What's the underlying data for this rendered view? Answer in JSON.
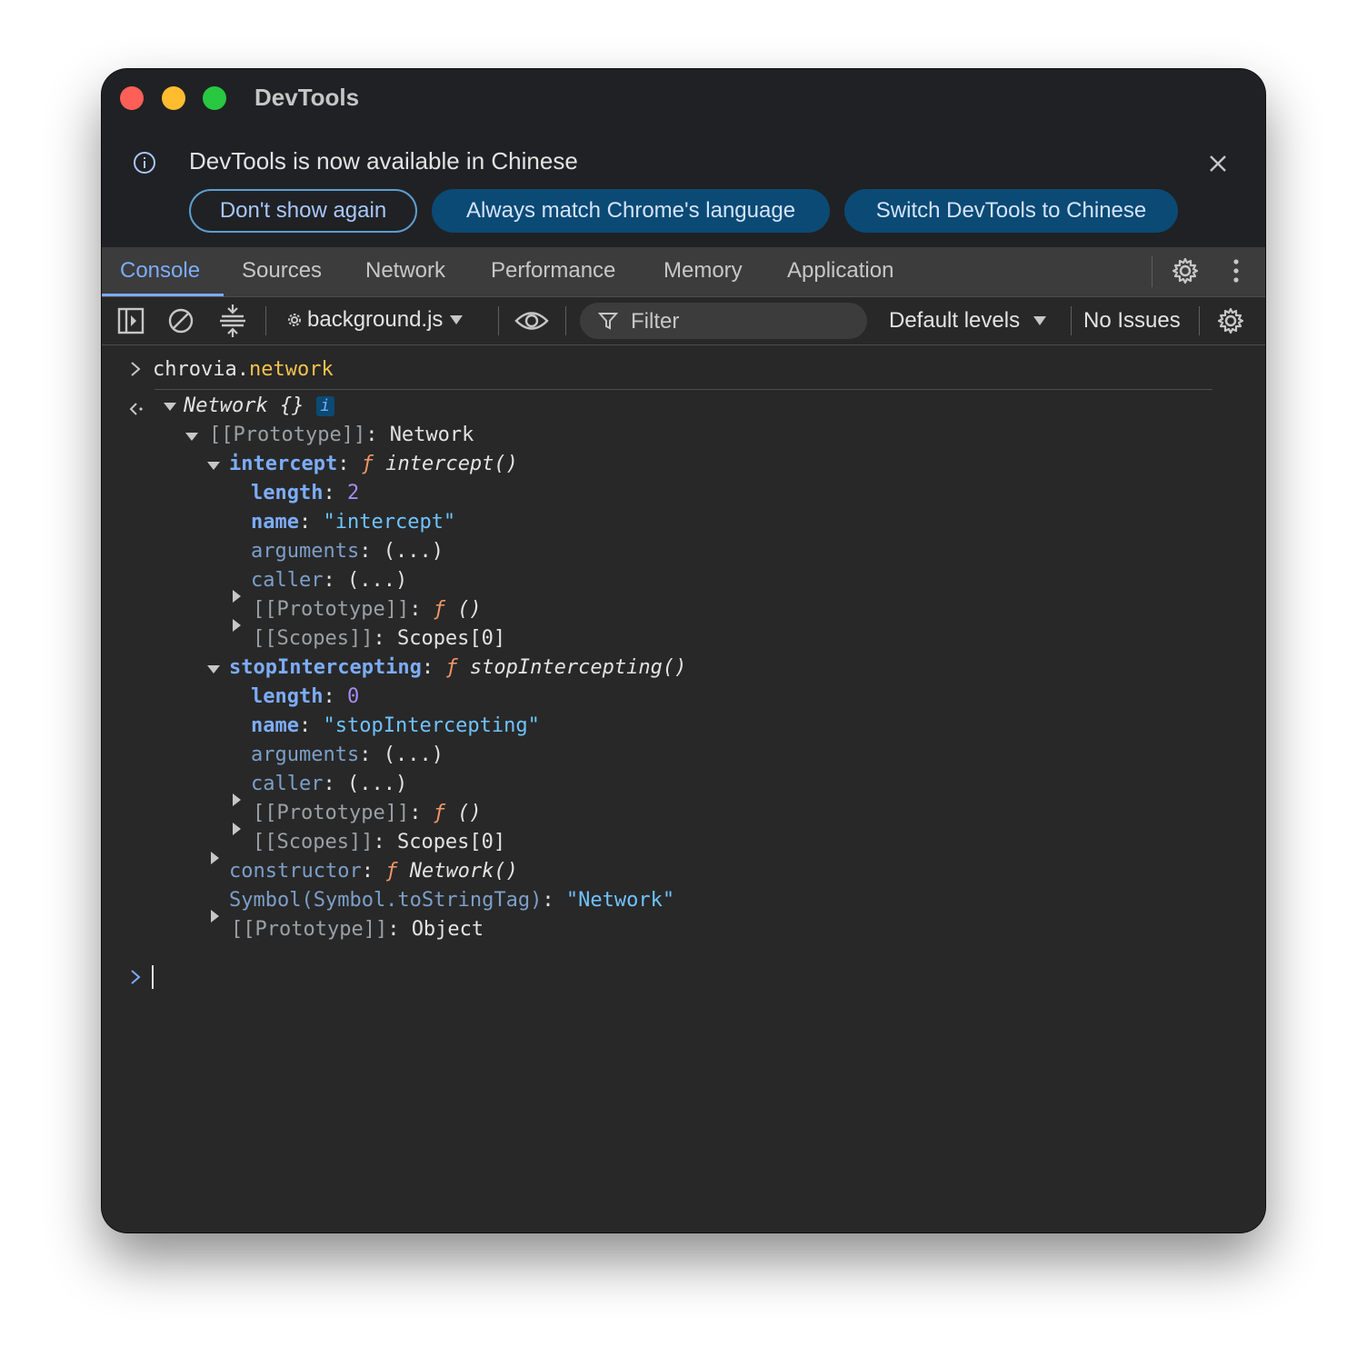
{
  "window": {
    "title": "DevTools"
  },
  "infobar": {
    "message": "DevTools is now available in Chinese",
    "buttons": [
      "Don't show again",
      "Always match Chrome's language",
      "Switch DevTools to Chinese"
    ]
  },
  "tabs": [
    "Console",
    "Sources",
    "Network",
    "Performance",
    "Memory",
    "Application"
  ],
  "toolbar": {
    "context": "background.js",
    "filter_placeholder": "Filter",
    "levels": "Default levels",
    "issues": "No Issues"
  },
  "console": {
    "input_expr_prefix": "chrovia.",
    "input_expr_prop": "network",
    "result_head": "Network {}",
    "info_badge": "i",
    "proto_label": "[[Prototype]]",
    "proto_value": "Network",
    "intercept": {
      "key": "intercept",
      "fn": "ƒ",
      "sig": "intercept()",
      "length_key": "length",
      "length_val": "2",
      "name_key": "name",
      "name_val": "\"intercept\"",
      "arguments_key": "arguments",
      "arguments_val": "(...)",
      "caller_key": "caller",
      "caller_val": "(...)",
      "proto_key": "[[Prototype]]",
      "proto_val": "()",
      "scopes_key": "[[Scopes]]",
      "scopes_val": "Scopes[0]"
    },
    "stop": {
      "key": "stopIntercepting",
      "fn": "ƒ",
      "sig": "stopIntercepting()",
      "length_key": "length",
      "length_val": "0",
      "name_key": "name",
      "name_val": "\"stopIntercepting\"",
      "arguments_key": "arguments",
      "arguments_val": "(...)",
      "caller_key": "caller",
      "caller_val": "(...)",
      "proto_key": "[[Prototype]]",
      "proto_val": "()",
      "scopes_key": "[[Scopes]]",
      "scopes_val": "Scopes[0]"
    },
    "constructor": {
      "key": "constructor",
      "fn": "ƒ",
      "sig": "Network()"
    },
    "symbol": {
      "key": "Symbol(Symbol.toStringTag)",
      "val": "\"Network\""
    },
    "object_proto": {
      "key": "[[Prototype]]",
      "val": "Object"
    }
  }
}
